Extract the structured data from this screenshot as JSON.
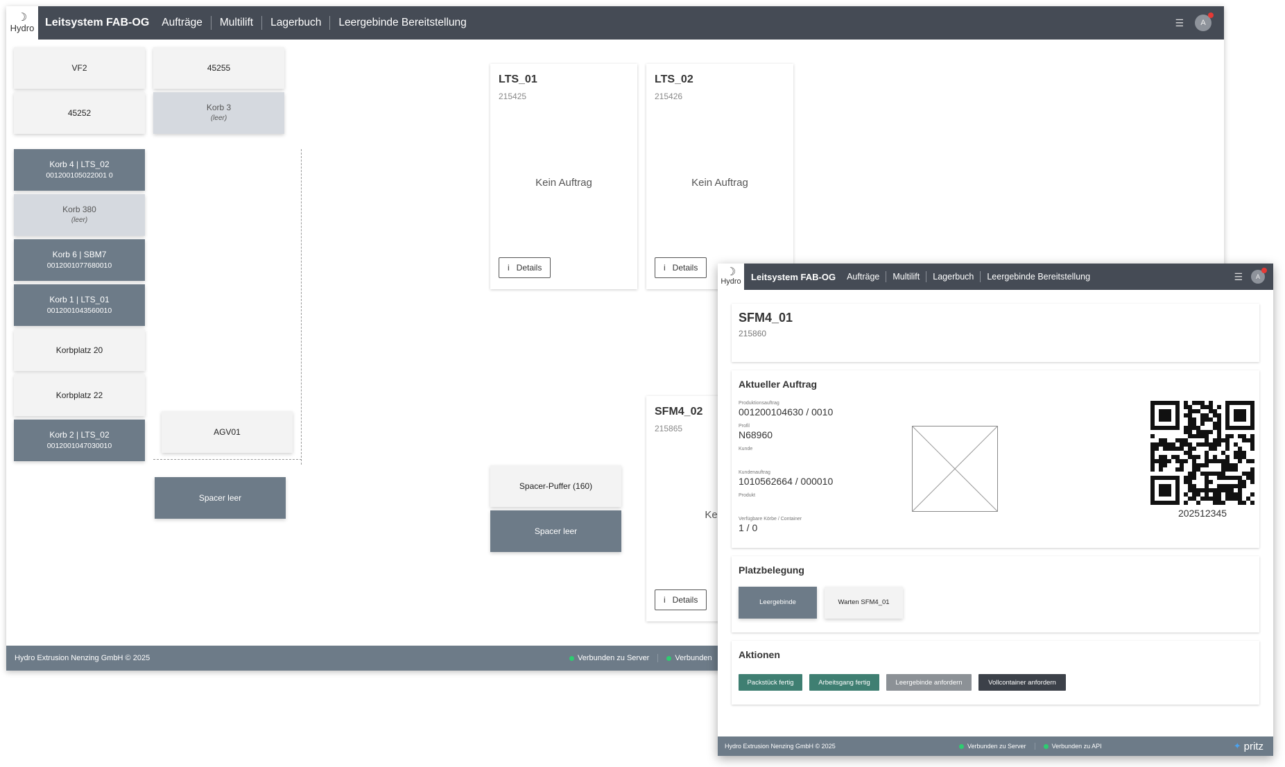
{
  "app": {
    "logo_text": "Hydro",
    "title": "Leitsystem FAB-OG",
    "nav": [
      "Aufträge",
      "Multilift",
      "Lagerbuch",
      "Leergebinde Bereitstellung"
    ],
    "avatar_initial": "A"
  },
  "main": {
    "tiles": {
      "vf2": "VF2",
      "t45255": "45255",
      "t45252": "45252",
      "korb3": {
        "title": "Korb 3",
        "sub": "(leer)"
      },
      "korb4": {
        "title": "Korb 4 | LTS_02",
        "sub": "001200105022001 0"
      },
      "korb380": {
        "title": "Korb 380",
        "sub": "(leer)"
      },
      "korb6": {
        "title": "Korb 6 | SBM7",
        "sub": "0012001077680010"
      },
      "korb1": {
        "title": "Korb 1 | LTS_01",
        "sub": "0012001043560010"
      },
      "korbplatz20": "Korbplatz 20",
      "korbplatz22": "Korbplatz 22",
      "korb2": {
        "title": "Korb 2 | LTS_02",
        "sub": "0012001047030010"
      },
      "agv01": "AGV01",
      "spacer_leer_1": "Spacer leer",
      "spacer_puffer": "Spacer-Puffer (160)",
      "spacer_leer_2": "Spacer leer"
    },
    "cards": [
      {
        "title": "LTS_01",
        "id": "215425",
        "status": "Kein Auftrag",
        "details": "Details"
      },
      {
        "title": "LTS_02",
        "id": "215426",
        "status": "Kein Auftrag",
        "details": "Details"
      },
      {
        "title": "SFM4_02",
        "id": "215865",
        "status": "Kein A",
        "details": "Details"
      }
    ],
    "footer": {
      "copyright": "Hydro Extrusion Nenzing GmbH © 2025",
      "server": "Verbunden zu Server",
      "api": "Verbunden"
    }
  },
  "detail": {
    "station": {
      "title": "SFM4_01",
      "id": "215860"
    },
    "order": {
      "heading": "Aktueller Auftrag",
      "production_order_label": "Produktionsauftrag",
      "production_order": "001200104630 / 0010",
      "profile_label": "Profil",
      "profile": "N68960",
      "customer_label": "Kunde",
      "customer_order_label": "Kundenauftrag",
      "customer_order": "1010562664 / 000010",
      "product_label": "Produkt",
      "available_label": "Verfügbare Körbe / Container",
      "available": "1 / 0",
      "qr_number": "202512345"
    },
    "placement": {
      "heading": "Platzbelegung",
      "leergebinde": "Leergebinde",
      "warten": "Warten SFM4_01"
    },
    "actions": {
      "heading": "Aktionen",
      "packstueck": "Packstück fertig",
      "arbeitsgang": "Arbeitsgang fertig",
      "leergebinde": "Leergebinde anfordern",
      "vollcontainer": "Vollcontainer anfordern"
    },
    "footer": {
      "copyright": "Hydro Extrusion Nenzing GmbH © 2025",
      "server": "Verbunden zu Server",
      "api": "Verbunden zu API",
      "brand": "pritz"
    }
  },
  "colors": {
    "nav": "#454b55",
    "tile_dark": "#6d7b88",
    "tile_light": "#d5d9df",
    "green": "#3f7f72",
    "gray_btn": "#8c9196",
    "dark_btn": "#3c4149"
  }
}
